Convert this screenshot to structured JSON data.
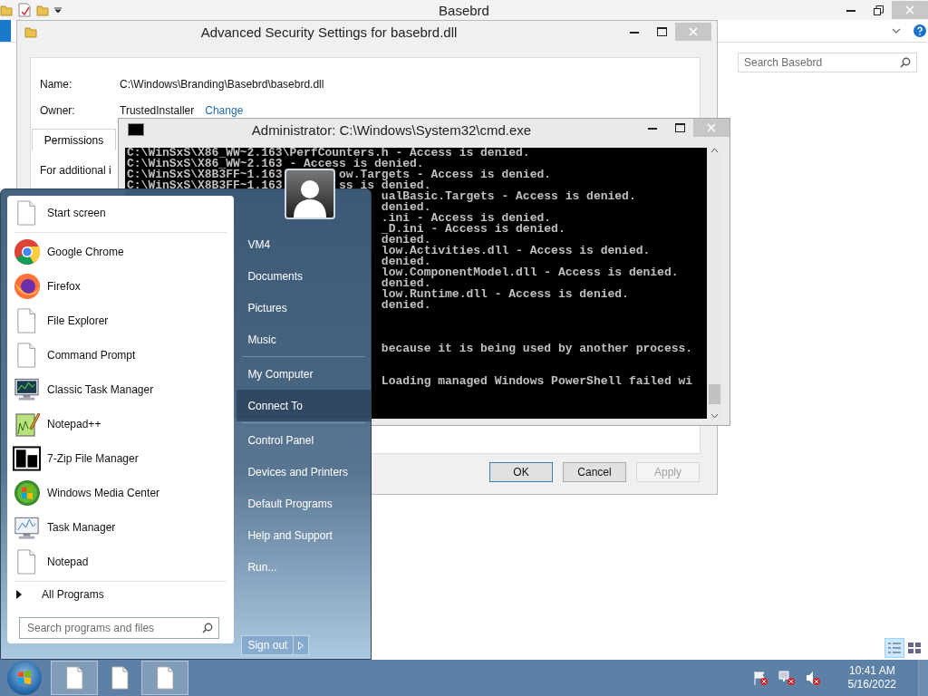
{
  "explorer": {
    "title": "Basebrd",
    "search": {
      "placeholder": "Search Basebrd"
    }
  },
  "security_dialog": {
    "title": "Advanced Security Settings for basebrd.dll",
    "fields": [
      {
        "label": "Name:",
        "value": "C:\\Windows\\Branding\\Basebrd\\basebrd.dll"
      },
      {
        "label": "Owner:",
        "value": "TrustedInstaller",
        "link": "Change"
      }
    ],
    "tabs": [
      {
        "label": "Permissions",
        "selected": true
      }
    ],
    "info_text": "For additional i",
    "buttons": [
      {
        "label": "OK",
        "kind": "default",
        "disabled": false
      },
      {
        "label": "Cancel",
        "kind": "normal",
        "disabled": false
      },
      {
        "label": "Apply",
        "kind": "normal",
        "disabled": true
      }
    ]
  },
  "console": {
    "title": "Administrator: C:\\Windows\\System32\\cmd.exe",
    "lines": [
      {
        "left": "C:\\WinSxS\\X86_WW~2.163\\PerfCounters.h - Access is denied."
      },
      {
        "left": "C:\\WinSxS\\X86_WW~2.163 - Access is denied."
      },
      {
        "left": "C:\\WinSxS\\X8B3FF~1.163",
        "right": "ow.Targets - Access is denied."
      },
      {
        "left": "C:\\WinSxS\\X8B3FF~1.163",
        "right": "ss is denied."
      },
      {
        "right": "ualBasic.Targets - Access is denied."
      },
      {
        "right": "denied."
      },
      {
        "right": ".ini - Access is denied."
      },
      {
        "right": "_D.ini - Access is denied."
      },
      {
        "right": "denied."
      },
      {
        "right": "low.Activities.dll - Access is denied."
      },
      {
        "right": "denied."
      },
      {
        "right": "low.ComponentModel.dll - Access is denied."
      },
      {
        "right": "denied."
      },
      {
        "right": "low.Runtime.dll - Access is denied."
      },
      {
        "right": "denied."
      },
      {
        "kind": "blank"
      },
      {
        "kind": "blank"
      },
      {
        "kind": "blank"
      },
      {
        "right": "because it is being used by another process."
      },
      {
        "kind": "blank"
      },
      {
        "kind": "blank"
      },
      {
        "right": "Loading managed Windows PowerShell failed wi"
      }
    ]
  },
  "start_menu": {
    "programs": [
      {
        "label": "Start screen"
      },
      {
        "label": "Google Chrome"
      },
      {
        "label": "Firefox"
      },
      {
        "label": "File Explorer"
      },
      {
        "label": "Command Prompt"
      },
      {
        "label": "Classic Task Manager"
      },
      {
        "label": "Notepad++"
      },
      {
        "label": "7-Zip File Manager"
      },
      {
        "label": "Windows Media Center"
      },
      {
        "label": "Task Manager"
      },
      {
        "label": "Notepad"
      }
    ],
    "all_programs": "All Programs",
    "search": {
      "placeholder": "Search programs and files"
    },
    "place_groups": [
      [
        {
          "label": "VM4",
          "selected": false
        },
        {
          "label": "Documents",
          "selected": false
        },
        {
          "label": "Pictures",
          "selected": false
        },
        {
          "label": "Music",
          "selected": false
        }
      ],
      [
        {
          "label": "My Computer",
          "selected": false
        },
        {
          "label": "Connect To",
          "selected": true
        }
      ],
      [
        {
          "label": "Control Panel",
          "selected": false
        },
        {
          "label": "Devices and Printers",
          "selected": false
        },
        {
          "label": "Default Programs",
          "selected": false
        },
        {
          "label": "Help and Support",
          "selected": false
        },
        {
          "label": "Run...",
          "selected": false
        }
      ]
    ],
    "sign_out": "Sign out"
  },
  "taskbar": {
    "buttons": [
      {
        "selected": true
      },
      {
        "selected": false
      },
      {
        "selected": true
      }
    ],
    "clock": {
      "time": "10:41 AM",
      "date": "5/16/2022"
    }
  }
}
